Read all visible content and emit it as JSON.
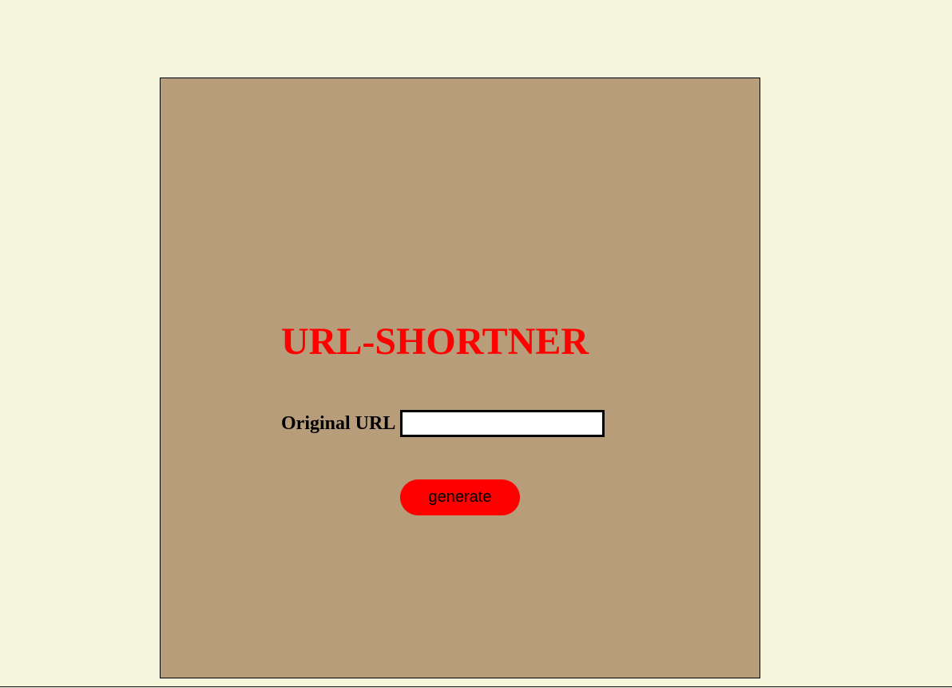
{
  "app": {
    "title": "URL-SHORTNER"
  },
  "form": {
    "original_url_label": "Original URL",
    "original_url_value": "",
    "original_url_placeholder": "",
    "generate_label": "generate"
  },
  "colors": {
    "page_background": "#f5f5dc",
    "card_background": "#b89d7a",
    "accent": "#ff0000"
  }
}
